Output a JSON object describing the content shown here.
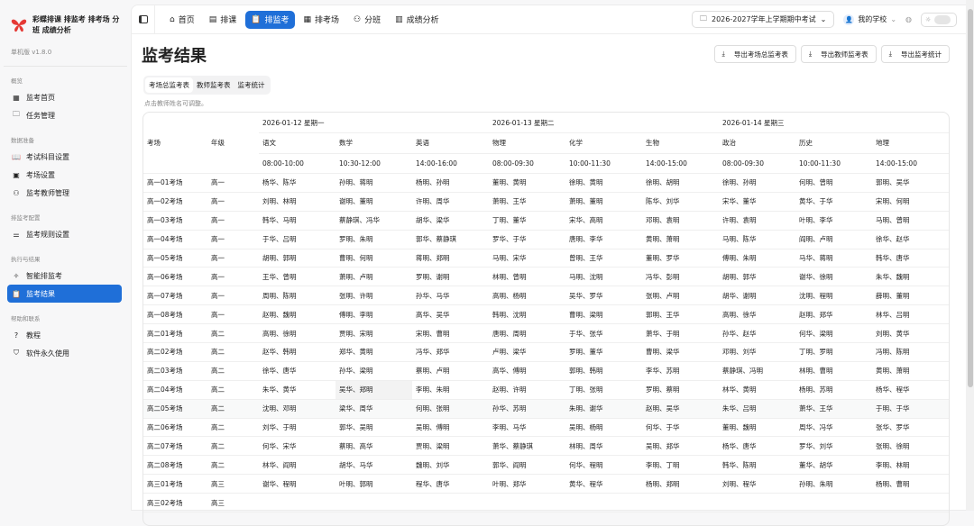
{
  "app": {
    "name": "彩蝶排课 排监考 排考场 分班 成绩分析",
    "version": "单机版 v1.8.0"
  },
  "sidebar": {
    "sections": [
      {
        "title": "概览",
        "items": [
          {
            "label": "监考首页",
            "icon": "grid-icon"
          },
          {
            "label": "任务管理",
            "icon": "folder-icon"
          }
        ]
      },
      {
        "title": "数据准备",
        "items": [
          {
            "label": "考试科目设置",
            "icon": "book-icon"
          },
          {
            "label": "考场设置",
            "icon": "building-icon"
          },
          {
            "label": "监考教师管理",
            "icon": "users-icon"
          }
        ]
      },
      {
        "title": "排监考配置",
        "items": [
          {
            "label": "监考规则设置",
            "icon": "sliders-icon"
          }
        ]
      },
      {
        "title": "执行与结果",
        "items": [
          {
            "label": "智能排监考",
            "icon": "wand-icon"
          },
          {
            "label": "监考结果",
            "icon": "clipboard-icon",
            "active": true
          }
        ]
      },
      {
        "title": "帮助和联系",
        "items": [
          {
            "label": "教程",
            "icon": "help-icon"
          },
          {
            "label": "软件永久使用",
            "icon": "shield-check-icon"
          }
        ]
      }
    ]
  },
  "topnav": {
    "tabs": [
      {
        "label": "首页",
        "icon": "home-icon"
      },
      {
        "label": "排课",
        "icon": "calendar-icon"
      },
      {
        "label": "排监考",
        "icon": "clipboard-icon",
        "active": true
      },
      {
        "label": "排考场",
        "icon": "table-icon"
      },
      {
        "label": "分班",
        "icon": "users-icon"
      },
      {
        "label": "成绩分析",
        "icon": "bar-chart-icon"
      }
    ],
    "exam": "2026-2027学年上学期期中考试",
    "school": "我的学校"
  },
  "page": {
    "title": "监考结果",
    "exports": [
      "导出考场总监考表",
      "导出教师监考表",
      "导出监考统计"
    ],
    "subtabs": [
      "考场总监考表",
      "教师监考表",
      "监考统计"
    ],
    "hint": "点击教师姓名可调整。"
  },
  "table": {
    "col_room": "考场",
    "col_grade": "年级",
    "dates": [
      "2026-01-12 星期一",
      "2026-01-13 星期二",
      "2026-01-14 星期三"
    ],
    "subjects": [
      "语文",
      "数学",
      "英语",
      "物理",
      "化学",
      "生物",
      "政治",
      "历史",
      "地理"
    ],
    "times": [
      "08:00-10:00",
      "10:30-12:00",
      "14:00-16:00",
      "08:00-09:30",
      "10:00-11:30",
      "14:00-15:00",
      "08:00-09:30",
      "10:00-11:30",
      "14:00-15:00"
    ],
    "rows": [
      {
        "room": "高一01考场",
        "grade": "高一",
        "cells": [
          "杨华、陈华",
          "孙明、蒋明",
          "杨明、孙明",
          "董明、黄明",
          "徐明、黄明",
          "徐明、胡明",
          "徐明、孙明",
          "何明、曾明",
          "郭明、吴华"
        ]
      },
      {
        "room": "高一02考场",
        "grade": "高一",
        "cells": [
          "刘明、林明",
          "谢明、董明",
          "许明、周华",
          "萧明、王华",
          "萧明、董明",
          "陈华、刘华",
          "宋华、董华",
          "黄华、于华",
          "宋明、何明"
        ]
      },
      {
        "room": "高一03考场",
        "grade": "高一",
        "cells": [
          "韩华、马明",
          "蔡静琪、冯华",
          "胡华、梁华",
          "丁明、董华",
          "宋华、高明",
          "邓明、袁明",
          "许明、袁明",
          "叶明、李华",
          "马明、曾明"
        ]
      },
      {
        "room": "高一04考场",
        "grade": "高一",
        "cells": [
          "于华、吕明",
          "罗明、朱明",
          "郭华、蔡静琪",
          "罗华、于华",
          "唐明、李华",
          "黄明、萧明",
          "马明、陈华",
          "阎明、卢明",
          "徐华、赵华"
        ]
      },
      {
        "room": "高一05考场",
        "grade": "高一",
        "cells": [
          "胡明、郭明",
          "曹明、何明",
          "蒋明、郑明",
          "马明、宋华",
          "曾明、王华",
          "董明、罗华",
          "傅明、朱明",
          "马华、蒋明",
          "韩华、唐华"
        ]
      },
      {
        "room": "高一06考场",
        "grade": "高一",
        "cells": [
          "王华、曾明",
          "萧明、卢明",
          "罗明、谢明",
          "林明、曾明",
          "马明、沈明",
          "冯华、彭明",
          "胡明、郭华",
          "谢华、徐明",
          "朱华、魏明"
        ]
      },
      {
        "room": "高一07考场",
        "grade": "高一",
        "cells": [
          "周明、陈明",
          "张明、许明",
          "孙华、马华",
          "高明、杨明",
          "吴华、罗华",
          "张明、卢明",
          "胡华、谢明",
          "沈明、程明",
          "薛明、董明"
        ]
      },
      {
        "room": "高一08考场",
        "grade": "高一",
        "cells": [
          "赵明、魏明",
          "傅明、李明",
          "高华、吴华",
          "韩明、沈明",
          "曹明、梁明",
          "郭明、王华",
          "高明、徐华",
          "赵明、郑华",
          "林华、吕明"
        ]
      },
      {
        "room": "高二01考场",
        "grade": "高二",
        "cells": [
          "高明、徐明",
          "贾明、宋明",
          "宋明、曹明",
          "唐明、周明",
          "于华、张华",
          "萧华、于明",
          "孙华、赵华",
          "何华、梁明",
          "刘明、黄华"
        ]
      },
      {
        "room": "高二02考场",
        "grade": "高二",
        "cells": [
          "赵华、韩明",
          "郑华、黄明",
          "冯华、郑华",
          "卢明、梁华",
          "罗明、董华",
          "曹明、梁华",
          "邓明、刘华",
          "丁明、罗明",
          "冯明、陈明"
        ]
      },
      {
        "room": "高二03考场",
        "grade": "高二",
        "cells": [
          "徐华、唐华",
          "孙华、梁明",
          "蔡明、卢明",
          "高华、傅明",
          "郭明、韩明",
          "李华、苏明",
          "蔡静琪、冯明",
          "林明、曹明",
          "黄明、萧明"
        ]
      },
      {
        "room": "高二04考场",
        "grade": "高二",
        "cells": [
          "朱华、黄华",
          "吴华、郑明",
          "李明、朱明",
          "赵明、许明",
          "丁明、张明",
          "罗明、蔡明",
          "林华、黄明",
          "杨明、苏明",
          "杨华、程华"
        ]
      },
      {
        "room": "高二05考场",
        "grade": "高二",
        "cells": [
          "沈明、邓明",
          "梁华、周华",
          "何明、张明",
          "孙华、苏明",
          "朱明、谢华",
          "赵明、吴华",
          "朱华、吕明",
          "萧华、王华",
          "于明、于华"
        ]
      },
      {
        "room": "高二06考场",
        "grade": "高二",
        "cells": [
          "刘华、于明",
          "郭华、吴明",
          "吴明、傅明",
          "李明、马华",
          "吴明、杨明",
          "何华、于华",
          "董明、魏明",
          "周华、冯华",
          "张华、罗华"
        ]
      },
      {
        "room": "高二07考场",
        "grade": "高二",
        "cells": [
          "何华、宋华",
          "蔡明、高华",
          "贾明、梁明",
          "萧华、蔡静琪",
          "林明、周华",
          "吴明、郑华",
          "杨华、唐华",
          "罗华、刘华",
          "张明、徐明"
        ]
      },
      {
        "room": "高二08考场",
        "grade": "高二",
        "cells": [
          "林华、阎明",
          "胡华、马华",
          "魏明、刘华",
          "郭华、阎明",
          "何华、程明",
          "李明、丁明",
          "韩华、陈明",
          "董华、胡华",
          "李明、林明"
        ]
      },
      {
        "room": "高三01考场",
        "grade": "高三",
        "cells": [
          "谢华、程明",
          "叶明、郭明",
          "程华、唐华",
          "叶明、郑华",
          "黄华、程华",
          "杨明、郑明",
          "刘明、程华",
          "孙明、朱明",
          "杨明、曹明"
        ]
      },
      {
        "room": "高三02考场",
        "grade": "高三",
        "cells": []
      }
    ]
  },
  "colors": {
    "accent": "#1f6fd8"
  }
}
